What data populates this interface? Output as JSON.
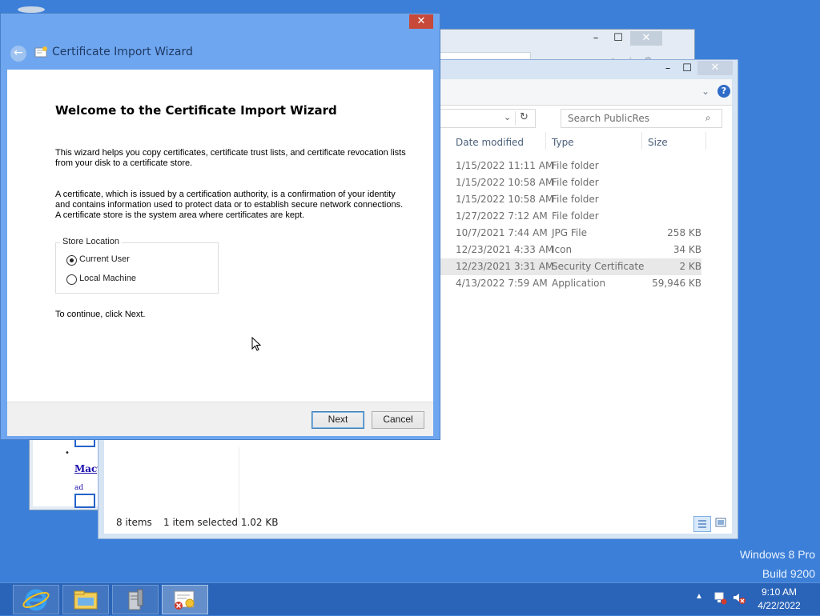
{
  "ie_window": {
    "ad_link": "Macy'",
    "ad_label": "ad"
  },
  "explorer": {
    "search_placeholder": "Search PublicRes",
    "columns": {
      "date": "Date modified",
      "type": "Type",
      "size": "Size"
    },
    "rows": [
      {
        "date": "1/15/2022 11:11 AM",
        "type": "File folder",
        "size": ""
      },
      {
        "date": "1/15/2022 10:58 AM",
        "type": "File folder",
        "size": ""
      },
      {
        "date": "1/15/2022 10:58 AM",
        "type": "File folder",
        "size": ""
      },
      {
        "date": "1/27/2022 7:12 AM",
        "type": "File folder",
        "size": ""
      },
      {
        "date": "10/7/2021 7:44 AM",
        "type": "JPG File",
        "size": "258 KB"
      },
      {
        "date": "12/23/2021 4:33 AM",
        "type": "Icon",
        "size": "34 KB"
      },
      {
        "date": "12/23/2021 3:31 AM",
        "type": "Security Certificate",
        "size": "2 KB"
      },
      {
        "date": "4/13/2022 7:59 AM",
        "type": "Application",
        "size": "59,946 KB"
      }
    ],
    "status": {
      "items": "8 items",
      "selected": "1 item selected  1.02 KB"
    }
  },
  "wizard": {
    "title": "Certificate Import Wizard",
    "heading": "Welcome to the Certificate Import Wizard",
    "para1": "This wizard helps you copy certificates, certificate trust lists, and certificate revocation lists from your disk to a certificate store.",
    "para2": "A certificate, which is issued by a certification authority, is a confirmation of your identity and contains information used to protect data or to establish secure network connections. A certificate store is the system area where certificates are kept.",
    "store_location_label": "Store Location",
    "options": [
      {
        "label": "Current User",
        "selected": true
      },
      {
        "label": "Local Machine",
        "selected": false
      }
    ],
    "continue_text": "To continue, click Next.",
    "next_label": "Next",
    "cancel_label": "Cancel"
  },
  "desktop": {
    "watermark_line1": "Windows 8 Pro",
    "watermark_line2": "Build 9200"
  },
  "taskbar": {
    "apps": [
      "internet-explorer-icon",
      "file-explorer-icon",
      "server-manager-icon",
      "certificate-icon"
    ],
    "time": "9:10 AM",
    "date": "4/22/2022"
  },
  "colors": {
    "desktop": "#3c7fd8",
    "taskbar": "#2a64b8",
    "wizard_frame": "#6fa6f0",
    "close_red": "#c7493a"
  }
}
